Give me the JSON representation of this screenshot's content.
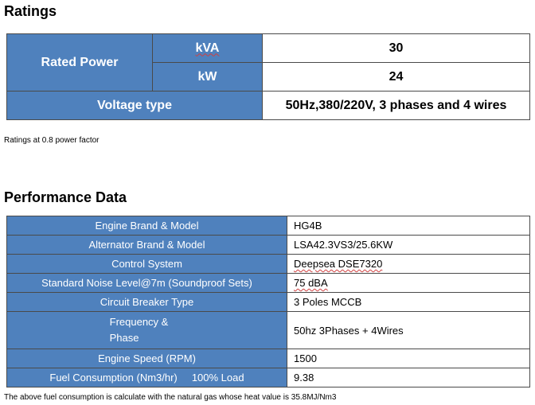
{
  "ratings": {
    "heading": "Ratings",
    "rated_power_label": "Rated  Power",
    "kva_label": "kVA",
    "kva_value": "30",
    "kw_label": "kW",
    "kw_value": "24",
    "voltage_label": "Voltage type",
    "voltage_value": "50Hz,380/220V, 3 phases and 4 wires",
    "note": "Ratings at 0.8 power factor"
  },
  "performance": {
    "heading": "Performance Data",
    "rows": [
      {
        "label": "Engine Brand & Model",
        "value": "HG4B"
      },
      {
        "label": "Alternator Brand & Model",
        "value": "LSA42.3VS3/25.6KW"
      },
      {
        "label": "Control System",
        "value": "Deepsea DSE7320"
      },
      {
        "label": "Standard Noise Level@7m (Soundproof Sets)",
        "value": "75 dBA"
      },
      {
        "label": "Circuit Breaker Type",
        "value": "3 Poles MCCB"
      },
      {
        "label_line1": "Frequency &",
        "label_line2": "Phase",
        "value": "50hz 3Phases + 4Wires"
      },
      {
        "label": "Engine Speed (RPM)",
        "value": "1500"
      },
      {
        "label": "Fuel Consumption (Nm3/hr)     100% Load",
        "value": "9.38"
      }
    ],
    "note": "The  above fuel consumption is calculate with the natural gas whose heat value is 35.8MJ/Nm3"
  }
}
